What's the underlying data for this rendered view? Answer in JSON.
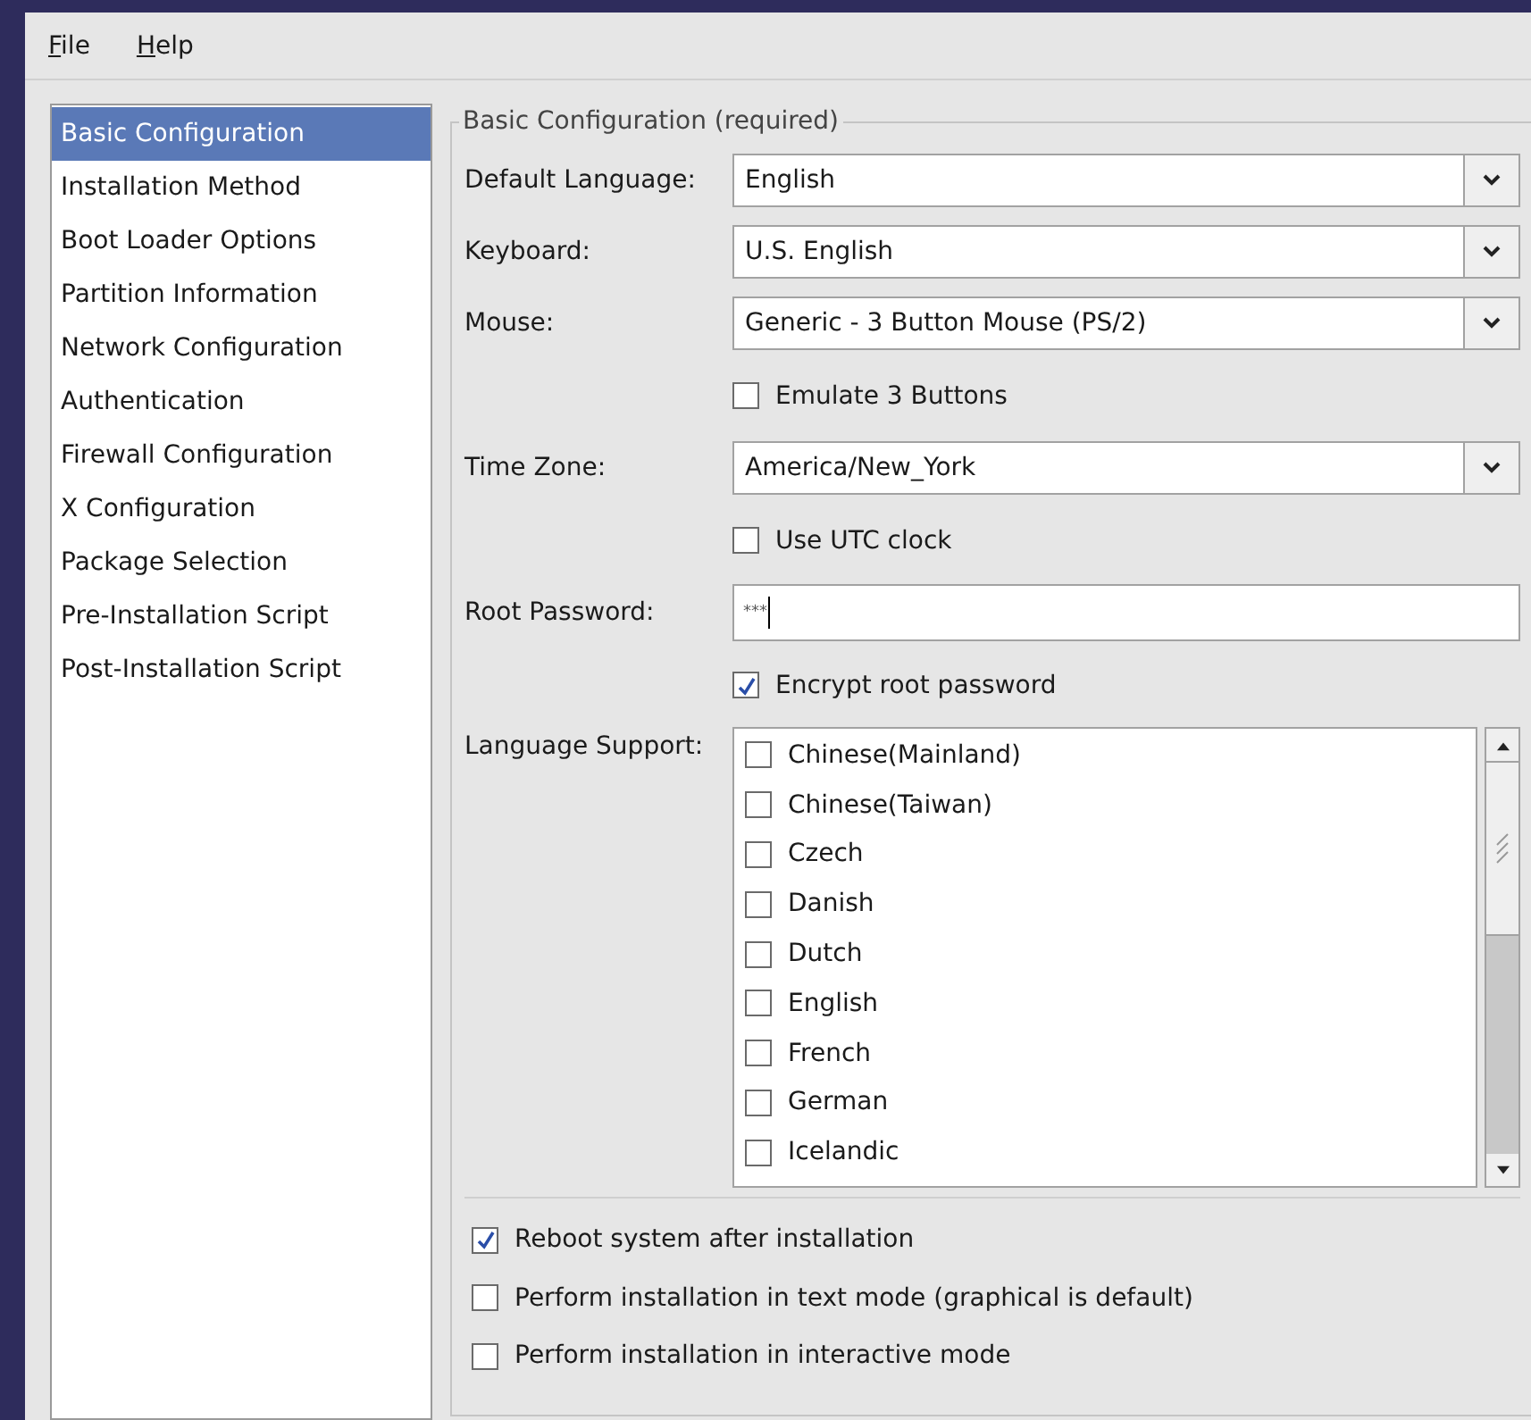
{
  "menu": [
    {
      "label": "File"
    },
    {
      "label": "Help"
    }
  ],
  "sidebar": {
    "items": [
      {
        "label": "Basic Configuration",
        "selected": true
      },
      {
        "label": "Installation Method",
        "selected": false
      },
      {
        "label": "Boot Loader Options",
        "selected": false
      },
      {
        "label": "Partition Information",
        "selected": false
      },
      {
        "label": "Network Configuration",
        "selected": false
      },
      {
        "label": "Authentication",
        "selected": false
      },
      {
        "label": "Firewall Configuration",
        "selected": false
      },
      {
        "label": "X Configuration",
        "selected": false
      },
      {
        "label": "Package Selection",
        "selected": false
      },
      {
        "label": "Pre-Installation Script",
        "selected": false
      },
      {
        "label": "Post-Installation Script",
        "selected": false
      }
    ]
  },
  "section": {
    "title": "Basic Configuration (required)",
    "fields": [
      {
        "kind": "combo",
        "label": "Default Language:",
        "value": "English"
      },
      {
        "kind": "combo",
        "label": "Keyboard:",
        "value": "U.S. English"
      },
      {
        "kind": "combo",
        "label": "Mouse:",
        "value": "Generic - 3 Button Mouse (PS/2)"
      },
      {
        "kind": "checkbox",
        "label": "Emulate 3 Buttons",
        "checked": false
      },
      {
        "kind": "combo",
        "label": "Time Zone:",
        "value": "America/New_York"
      },
      {
        "kind": "checkbox",
        "label": "Use UTC clock",
        "checked": false
      },
      {
        "kind": "password",
        "label": "Root Password:",
        "value": "***"
      },
      {
        "kind": "checkbox",
        "label": "Encrypt root password",
        "checked": true
      },
      {
        "kind": "checklist",
        "label": "Language Support:",
        "items": [
          {
            "label": "Chinese(Mainland)",
            "checked": false
          },
          {
            "label": "Chinese(Taiwan)",
            "checked": false
          },
          {
            "label": "Czech",
            "checked": false
          },
          {
            "label": "Danish",
            "checked": false
          },
          {
            "label": "Dutch",
            "checked": false
          },
          {
            "label": "English",
            "checked": false
          },
          {
            "label": "French",
            "checked": false
          },
          {
            "label": "German",
            "checked": false
          },
          {
            "label": "Icelandic",
            "checked": false
          }
        ]
      }
    ],
    "options": [
      {
        "label": "Reboot system after installation",
        "checked": true
      },
      {
        "label": "Perform installation in text mode (graphical is default)",
        "checked": false
      },
      {
        "label": "Perform installation in interactive mode",
        "checked": false
      }
    ]
  }
}
